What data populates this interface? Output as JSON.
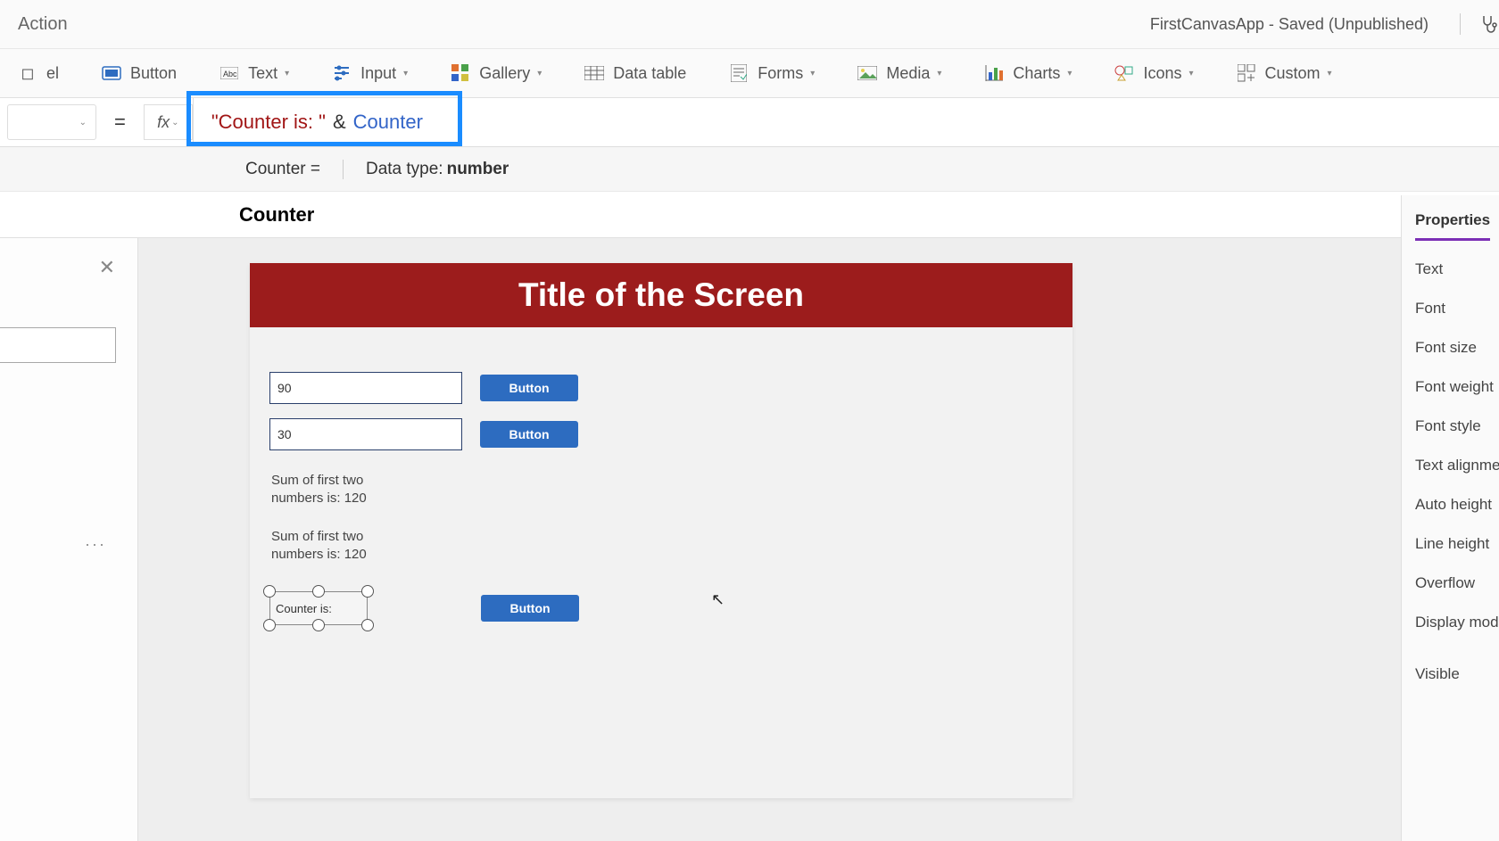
{
  "topbar": {
    "left": "Action",
    "right": "FirstCanvasApp - Saved (Unpublished)"
  },
  "ribbon": {
    "label": "el",
    "button": "Button",
    "text": "Text",
    "input": "Input",
    "gallery": "Gallery",
    "datatable": "Data table",
    "forms": "Forms",
    "media": "Media",
    "charts": "Charts",
    "icons": "Icons",
    "custom": "Custom"
  },
  "formula": {
    "eq": "=",
    "str": "\"Counter is: \"",
    "op": "&",
    "var": "Counter"
  },
  "infobar": {
    "counter": "Counter  =",
    "typelabel": "Data type:",
    "typeval": "number"
  },
  "title": "Counter",
  "canvas": {
    "heading": "Title of the Screen",
    "input1": "90",
    "input2": "30",
    "btn": "Button",
    "sum1": "Sum of first two numbers is: 120",
    "sum2": "Sum of first two numbers is: 120",
    "selected": "Counter is:"
  },
  "props": {
    "tab": "Properties",
    "items": [
      "Text",
      "Font",
      "Font size",
      "Font weight",
      "Font style",
      "Text alignme",
      "Auto height",
      "Line height",
      "Overflow",
      "Display mod",
      "Visible"
    ]
  }
}
